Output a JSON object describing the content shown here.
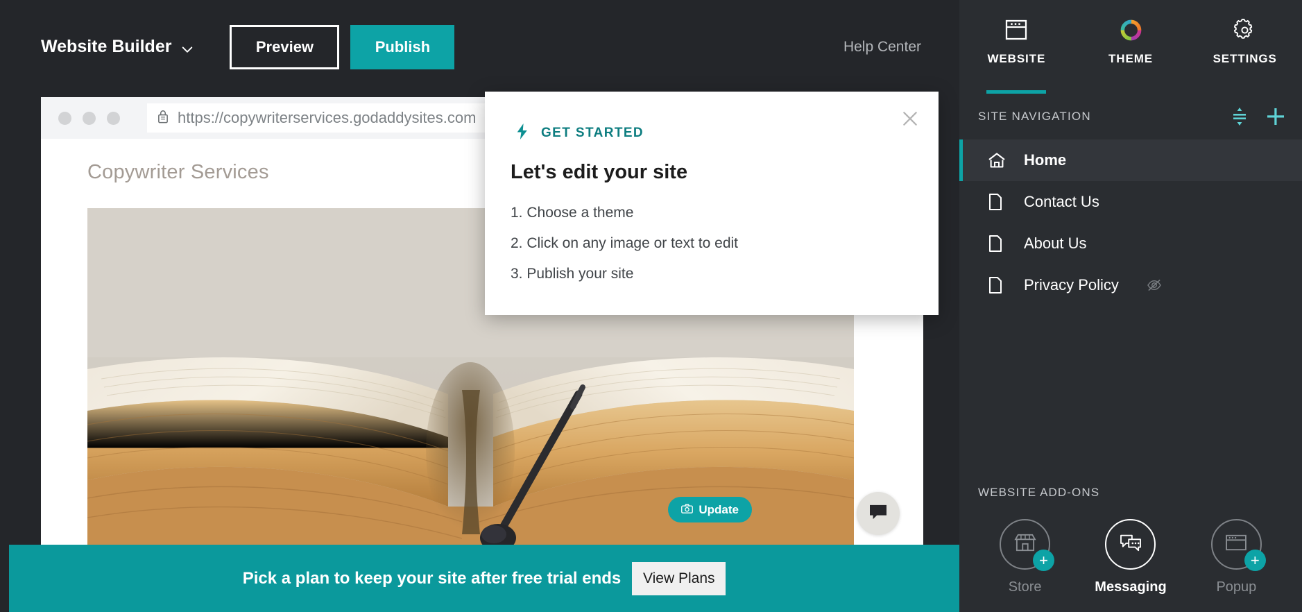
{
  "colors": {
    "teal": "#0da3a6",
    "teal_dark": "#0b999c",
    "teal_text": "#0d7d80",
    "panel_bg": "#2a2d31",
    "toolbar_bg": "#24262a",
    "row_active_bg": "#33363b"
  },
  "toolbar": {
    "brand": "Website Builder",
    "brand_caret_icon": "chevron-down-icon",
    "preview_label": "Preview",
    "publish_label": "Publish",
    "help_center_label": "Help Center"
  },
  "browser": {
    "lock_icon": "lock-icon",
    "url": "https://copywriterservices.godaddysites.com",
    "dots": 3
  },
  "page": {
    "title": "Copywriter Services",
    "hero_image_alt": "open-book-with-pen",
    "update_label": "Update",
    "update_icon": "camera-icon",
    "chat_icon": "chat-bubble-icon"
  },
  "trial_banner": {
    "message": "Pick a plan to keep your site after free trial ends",
    "cta_label": "View Plans"
  },
  "modal": {
    "eyebrow_icon": "lightning-bolt-icon",
    "eyebrow": "GET STARTED",
    "title": "Let's edit your site",
    "steps": [
      "1. Choose a theme",
      "2. Click on any image or text to edit",
      "3. Publish your site"
    ],
    "close_icon": "close-icon"
  },
  "panel": {
    "tabs": [
      {
        "label": "WEBSITE",
        "icon": "browser-window-icon",
        "active": true
      },
      {
        "label": "THEME",
        "icon": "color-wheel-icon",
        "active": false
      },
      {
        "label": "SETTINGS",
        "icon": "gear-icon",
        "active": false
      }
    ],
    "site_navigation": {
      "title": "SITE NAVIGATION",
      "reorder_icon": "reorder-icon",
      "add_icon": "plus-icon",
      "items": [
        {
          "label": "Home",
          "icon": "home-icon",
          "active": true,
          "hidden": false
        },
        {
          "label": "Contact Us",
          "icon": "page-icon",
          "active": false,
          "hidden": false
        },
        {
          "label": "About Us",
          "icon": "page-icon",
          "active": false,
          "hidden": false
        },
        {
          "label": "Privacy Policy",
          "icon": "page-icon",
          "active": false,
          "hidden": true,
          "hidden_icon": "eye-slash-icon"
        }
      ]
    },
    "addons": {
      "title": "WEBSITE ADD-ONS",
      "items": [
        {
          "label": "Store",
          "icon": "storefront-icon",
          "active": false,
          "badge": "+"
        },
        {
          "label": "Messaging",
          "icon": "chat-bubbles-icon",
          "active": true,
          "badge": ""
        },
        {
          "label": "Popup",
          "icon": "popup-window-icon",
          "active": false,
          "badge": "+"
        }
      ]
    }
  }
}
